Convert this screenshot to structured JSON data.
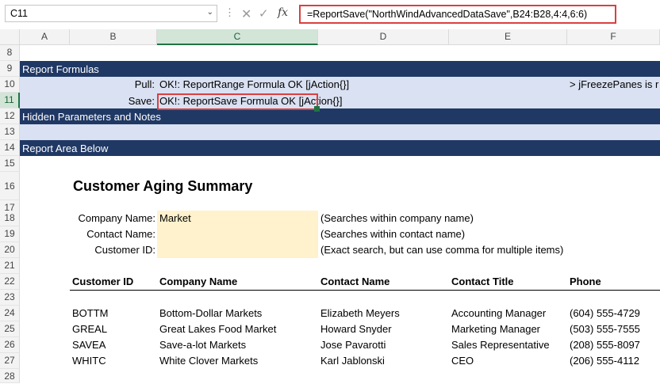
{
  "formula_bar": {
    "name_box": "C11",
    "formula": "=ReportSave(\"NorthWindAdvancedDataSave\",B24:B28,4:4,6:6)"
  },
  "columns": [
    "A",
    "B",
    "C",
    "D",
    "E",
    "F"
  ],
  "selected_column": "C",
  "rows": [
    "8",
    "9",
    "10",
    "11",
    "12",
    "13",
    "14",
    "15",
    "16",
    "17",
    "18",
    "19",
    "20",
    "21",
    "22",
    "23",
    "24",
    "25",
    "26",
    "27",
    "28"
  ],
  "selected_row": "11",
  "bands": {
    "report_formulas": "Report Formulas",
    "hidden_params": "Hidden Parameters and Notes",
    "report_area": "Report Area Below"
  },
  "pull": {
    "label": "Pull:",
    "value": "OK!: ReportRange Formula OK [jAction{}]",
    "note": "> jFreezePanes is r"
  },
  "save": {
    "label": "Save:",
    "value": "OK!: ReportSave Formula OK [jAction{}]"
  },
  "report": {
    "title": "Customer Aging Summary",
    "filters": [
      {
        "label": "Company Name:",
        "value": "Market",
        "hint": "(Searches within company name)"
      },
      {
        "label": "Contact Name:",
        "value": "",
        "hint": "(Searches within contact name)"
      },
      {
        "label": "Customer ID:",
        "value": "",
        "hint": "(Exact search, but can use comma for multiple items)"
      }
    ],
    "headers": [
      "Customer ID",
      "Company Name",
      "Contact Name",
      "Contact Title",
      "Phone"
    ],
    "rows": [
      [
        "BOTTM",
        "Bottom-Dollar Markets",
        "Elizabeth Meyers",
        "Accounting Manager",
        "(604) 555-4729"
      ],
      [
        "GREAL",
        "Great Lakes Food Market",
        "Howard Snyder",
        "Marketing Manager",
        "(503) 555-7555"
      ],
      [
        "SAVEA",
        "Save-a-lot Markets",
        "Jose Pavarotti",
        "Sales Representative",
        "(208) 555-8097"
      ],
      [
        "WHITC",
        "White Clover Markets",
        "Karl Jablonski",
        "CEO",
        "(206) 555-4112"
      ]
    ]
  }
}
